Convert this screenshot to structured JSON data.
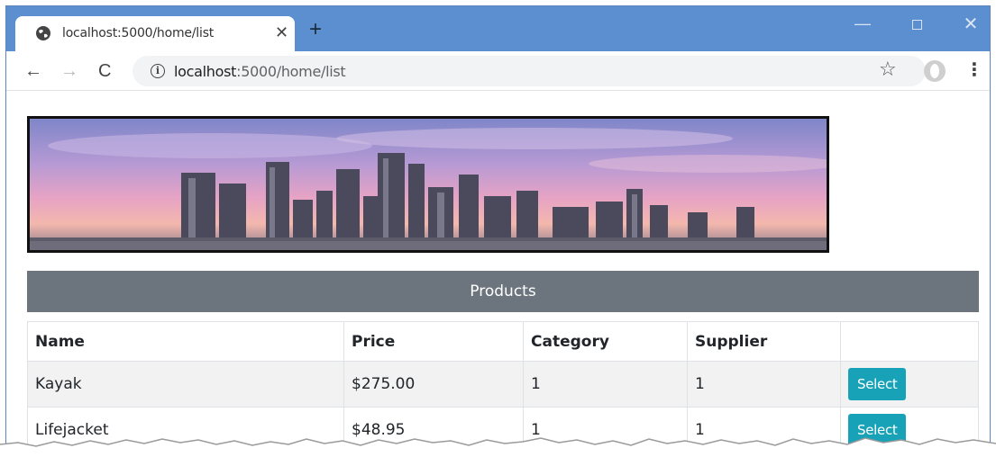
{
  "browser": {
    "tab_title": "localhost:5000/home/list",
    "tab_close": "✕",
    "new_tab": "+",
    "url_host": "localhost",
    "url_rest": ":5000/home/list",
    "window_controls": {
      "minimize": "—",
      "close": "✕"
    },
    "nav": {
      "back": "←",
      "forward": "→",
      "reload": "C"
    },
    "info_symbol": "i",
    "star": "☆",
    "menu": "⋮"
  },
  "page": {
    "banner_alt": "city skyline",
    "products_title": "Products",
    "table": {
      "headers": [
        "Name",
        "Price",
        "Category",
        "Supplier",
        ""
      ],
      "rows": [
        {
          "name": "Kayak",
          "price": "$275.00",
          "category": "1",
          "supplier": "1",
          "action": "Select"
        },
        {
          "name": "Lifejacket",
          "price": "$48.95",
          "category": "1",
          "supplier": "1",
          "action": "Select"
        }
      ]
    }
  },
  "colors": {
    "titlebar": "#5b8fcf",
    "header_bar": "#6c757d",
    "select_button": "#17a2b8"
  }
}
